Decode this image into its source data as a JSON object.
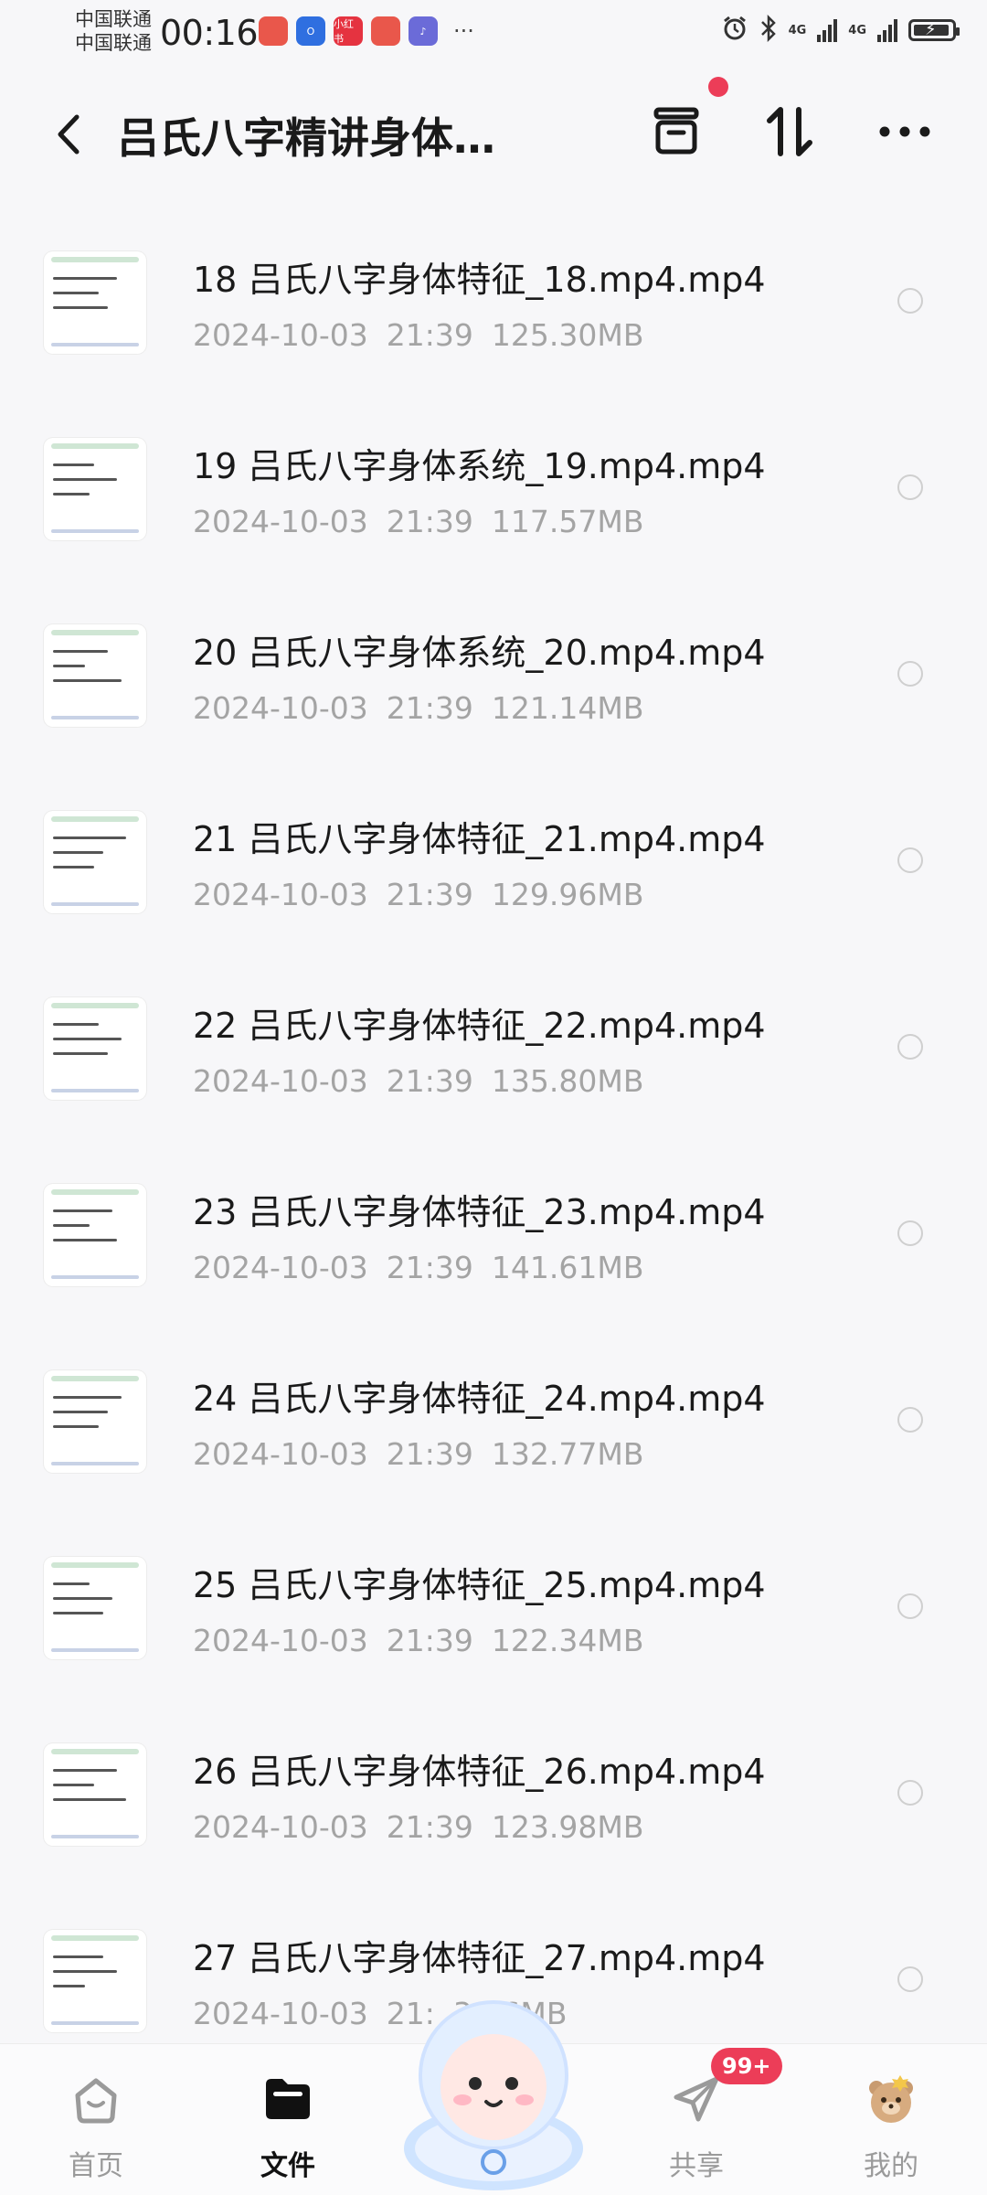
{
  "status_bar": {
    "carrier_1": "中国联通",
    "carrier_2": "中国联通",
    "time": "00:16",
    "app_notifications": [
      {
        "name": "huawei-mall-icon",
        "color": "#e9574b",
        "label": ""
      },
      {
        "name": "o-app-icon",
        "color": "#2f6fe0",
        "label": "O"
      },
      {
        "name": "xiaohongshu-icon",
        "color": "#e53340",
        "label": "小红书"
      },
      {
        "name": "huawei-app-icon",
        "color": "#e9574b",
        "label": ""
      },
      {
        "name": "music-icon",
        "color": "#6b6bd8",
        "label": "♪"
      }
    ],
    "more_dots": "···",
    "network_1": "4G",
    "network_2": "4G"
  },
  "header": {
    "title": "吕氏八字精讲身体…"
  },
  "files": [
    {
      "name": "18 吕氏八字身体特征_18.mp4.mp4",
      "date": "2024-10-03",
      "time": "21:39",
      "size": "125.30MB"
    },
    {
      "name": "19 吕氏八字身体系统_19.mp4.mp4",
      "date": "2024-10-03",
      "time": "21:39",
      "size": "117.57MB"
    },
    {
      "name": "20 吕氏八字身体系统_20.mp4.mp4",
      "date": "2024-10-03",
      "time": "21:39",
      "size": "121.14MB"
    },
    {
      "name": "21 吕氏八字身体特征_21.mp4.mp4",
      "date": "2024-10-03",
      "time": "21:39",
      "size": "129.96MB"
    },
    {
      "name": "22 吕氏八字身体特征_22.mp4.mp4",
      "date": "2024-10-03",
      "time": "21:39",
      "size": "135.80MB"
    },
    {
      "name": "23 吕氏八字身体特征_23.mp4.mp4",
      "date": "2024-10-03",
      "time": "21:39",
      "size": "141.61MB"
    },
    {
      "name": "24 吕氏八字身体特征_24.mp4.mp4",
      "date": "2024-10-03",
      "time": "21:39",
      "size": "132.77MB"
    },
    {
      "name": "25 吕氏八字身体特征_25.mp4.mp4",
      "date": "2024-10-03",
      "time": "21:39",
      "size": "122.34MB"
    },
    {
      "name": "26 吕氏八字身体特征_26.mp4.mp4",
      "date": "2024-10-03",
      "time": "21:39",
      "size": "123.98MB"
    },
    {
      "name": "27 吕氏八字身体特征_27.mp4.mp4",
      "date": "2024-10-03",
      "time": "21:",
      "size": "3.06MB"
    }
  ],
  "bottom_nav": {
    "home": "首页",
    "files": "文件",
    "share": "共享",
    "mine": "我的",
    "share_badge": "99+"
  },
  "colors": {
    "accent_red": "#ec3d58",
    "muted_text": "#a4a4a4"
  }
}
